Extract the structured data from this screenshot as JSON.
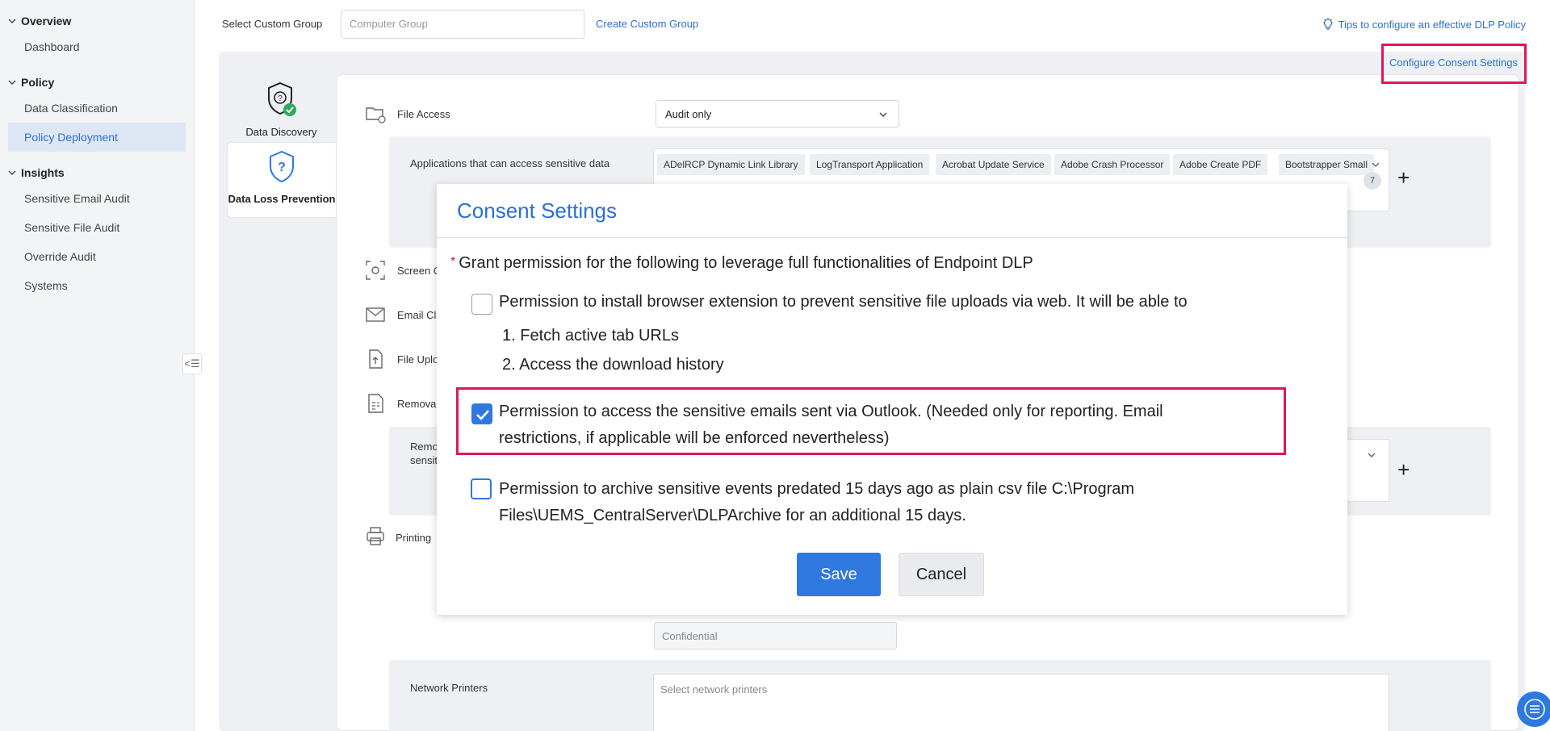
{
  "sidebar": {
    "sections": [
      {
        "title": "Overview",
        "items": [
          "Dashboard"
        ]
      },
      {
        "title": "Policy",
        "items": [
          "Data Classification",
          "Policy Deployment"
        ]
      },
      {
        "title": "Insights",
        "items": [
          "Sensitive Email Audit",
          "Sensitive File Audit",
          "Override Audit",
          "Systems"
        ]
      }
    ],
    "active_item": "Policy Deployment",
    "collapse_icon": "collapse-left-icon"
  },
  "topbar": {
    "custom_group_label": "Select Custom Group",
    "custom_group_placeholder": "Computer Group",
    "create_link": "Create Custom Group",
    "tips_link": "Tips to configure an effective DLP Policy",
    "tips_icon": "lightbulb-icon"
  },
  "tabs": {
    "data_discovery": "Data Discovery",
    "data_loss_prevention": "Data Loss Prevention"
  },
  "configure_consent": "Configure Consent Settings",
  "main": {
    "file_access_label": "File Access",
    "file_access_value": "Audit only",
    "apps_label": "Applications that can access sensitive data",
    "apps": [
      "ADelRCP Dynamic Link Library",
      "LogTransport Application",
      "Acrobat Update Service",
      "Adobe Crash Processor",
      "Adobe Create PDF",
      "Bootstrapper Small"
    ],
    "apps_more_count": "7",
    "screen_label": "Screen C",
    "email_label": "Email Cli",
    "file_upload_label": "File Uplo",
    "removable_label": "Removal",
    "removable_sub_line1": "Remo",
    "removable_sub_line2": "sensit",
    "printing_label": "Printing",
    "confidential_placeholder": "Confidential",
    "network_printers_label": "Network Printers",
    "network_printers_placeholder": "Select network printers"
  },
  "modal": {
    "title": "Consent Settings",
    "grant_text": "Grant permission for the following to leverage full functionalities of Endpoint DLP",
    "perm1": "Permission to install browser extension to prevent sensitive file uploads via web. It will be able to",
    "perm1_sub1": "1. Fetch active tab URLs",
    "perm1_sub2": "2. Access the download history",
    "perm2_line1": "Permission to access the sensitive emails sent via Outlook. (Needed only for reporting. Email",
    "perm2_line2": "restrictions, if applicable will be enforced nevertheless)",
    "perm3_line1": "Permission to archive sensitive events predated 15 days ago as plain csv file C:\\Program",
    "perm3_line2": "Files\\UEMS_CentralServer\\DLPArchive for an additional 15 days.",
    "save": "Save",
    "cancel": "Cancel",
    "perm1_checked": false,
    "perm2_checked": true,
    "perm3_checked": false
  },
  "colors": {
    "accent": "#2f78e0",
    "highlight": "#e0155b"
  }
}
